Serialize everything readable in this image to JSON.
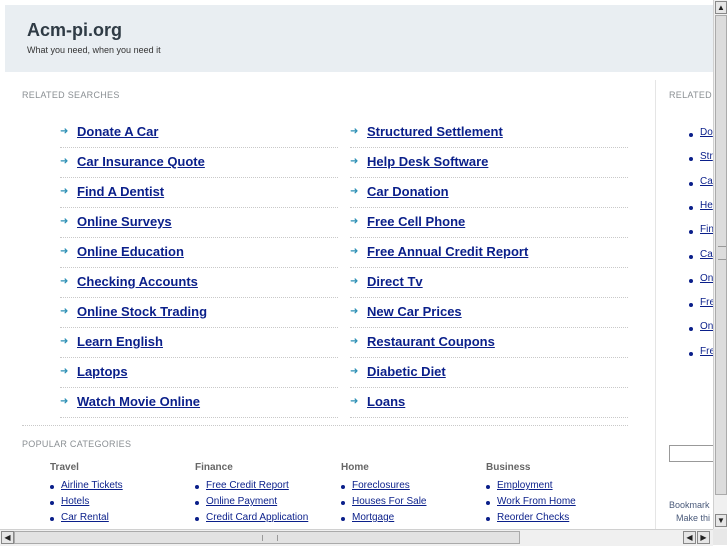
{
  "header": {
    "title": "Acm-pi.org",
    "tagline": "What you need, when you need it"
  },
  "related_searches": {
    "label": "RELATED SEARCHES",
    "left": [
      "Donate A Car",
      "Car Insurance Quote",
      "Find A Dentist",
      "Online Surveys",
      "Online Education",
      "Checking Accounts",
      "Online Stock Trading",
      "Learn English",
      "Laptops",
      "Watch Movie Online"
    ],
    "right": [
      "Structured Settlement",
      "Help Desk Software",
      "Car Donation",
      "Free Cell Phone",
      "Free Annual Credit Report",
      "Direct Tv",
      "New Car Prices",
      "Restaurant Coupons",
      "Diabetic Diet",
      "Loans"
    ]
  },
  "right_column": {
    "label": "RELATED",
    "items": [
      "Do",
      "Str",
      "Ca",
      "He",
      "Fin",
      "Ca",
      "On",
      "Fre",
      "On",
      "Fre"
    ],
    "bookmark": "Bookmark",
    "make": "Make thi"
  },
  "popular_categories": {
    "label": "POPULAR CATEGORIES",
    "columns": [
      {
        "title": "Travel",
        "items": [
          "Airline Tickets",
          "Hotels",
          "Car Rental"
        ]
      },
      {
        "title": "Finance",
        "items": [
          "Free Credit Report",
          "Online Payment",
          "Credit Card Application"
        ]
      },
      {
        "title": "Home",
        "items": [
          "Foreclosures",
          "Houses For Sale",
          "Mortgage"
        ]
      },
      {
        "title": "Business",
        "items": [
          "Employment",
          "Work From Home",
          "Reorder Checks"
        ]
      }
    ]
  },
  "icons": {
    "arrow": "arrow-right-icon",
    "up": "scroll-up-icon",
    "down": "scroll-down-icon",
    "left": "scroll-left-icon",
    "right": "scroll-right-icon"
  },
  "colors": {
    "header_bg": "#e9eef2",
    "link": "#0a1f8a",
    "arrow": "#2b8fb4"
  }
}
